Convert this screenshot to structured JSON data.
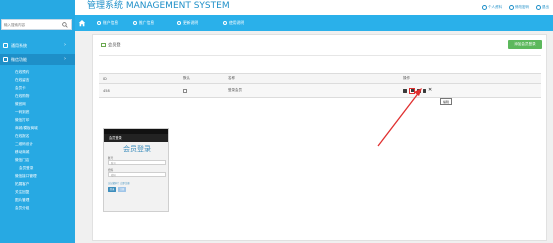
{
  "header": {
    "title": "管理系统 MANAGEMENT SYSTEM",
    "user_links": [
      {
        "label": "个人资料",
        "icon": "user-icon"
      },
      {
        "label": "修改密码",
        "icon": "key-icon"
      },
      {
        "label": "退出",
        "icon": "power-icon"
      }
    ]
  },
  "sidebar": {
    "search": {
      "placeholder": "输入搜索内容",
      "value": ""
    },
    "groups": [
      {
        "label": "通用系统",
        "icon": "gear-icon"
      },
      {
        "label": "微信功能",
        "icon": "grid-icon"
      }
    ],
    "items": [
      "在线预约",
      "在线留言",
      "会员卡",
      "在线购物",
      "微官网",
      "一码到底",
      "微信打印",
      "商城/模板商城",
      "在线报名",
      "二维码设计",
      "移动商城",
      "微信门店",
      "会员登录",
      "微信接口管理",
      "拓展客户",
      "关注回复",
      "图片管理",
      "会员分组"
    ],
    "selected_index": 12
  },
  "topnav": {
    "items": [
      {
        "label": "账户信息",
        "icon": "person-icon"
      },
      {
        "label": "推广信息",
        "icon": "share-icon"
      },
      {
        "label": "更新说明",
        "icon": "refresh-icon"
      },
      {
        "label": "使用说明",
        "icon": "eye-icon"
      }
    ]
  },
  "panel": {
    "title": "会员登",
    "add_button": "添加会员登录",
    "table": {
      "headers": [
        "ID",
        "默认",
        "名称",
        "操作"
      ],
      "rows": [
        {
          "id": "458",
          "default_checked": false,
          "name": "登录会员"
        }
      ]
    },
    "tooltip": "编辑",
    "example_label": "示例："
  },
  "phone": {
    "header_title": "会员登录",
    "big_title": "会员登录",
    "fields": [
      {
        "label": "账号",
        "placeholder": "账号"
      },
      {
        "label": "密码",
        "placeholder": "密码"
      }
    ],
    "link_text": "忘记密码？立即注册",
    "buttons": [
      "登录",
      "注册"
    ]
  },
  "colors": {
    "sidebar": "#27a9e3",
    "topnav": "#2ab0ea",
    "accent_green": "#5cb85c",
    "highlight_red": "#e03030"
  }
}
